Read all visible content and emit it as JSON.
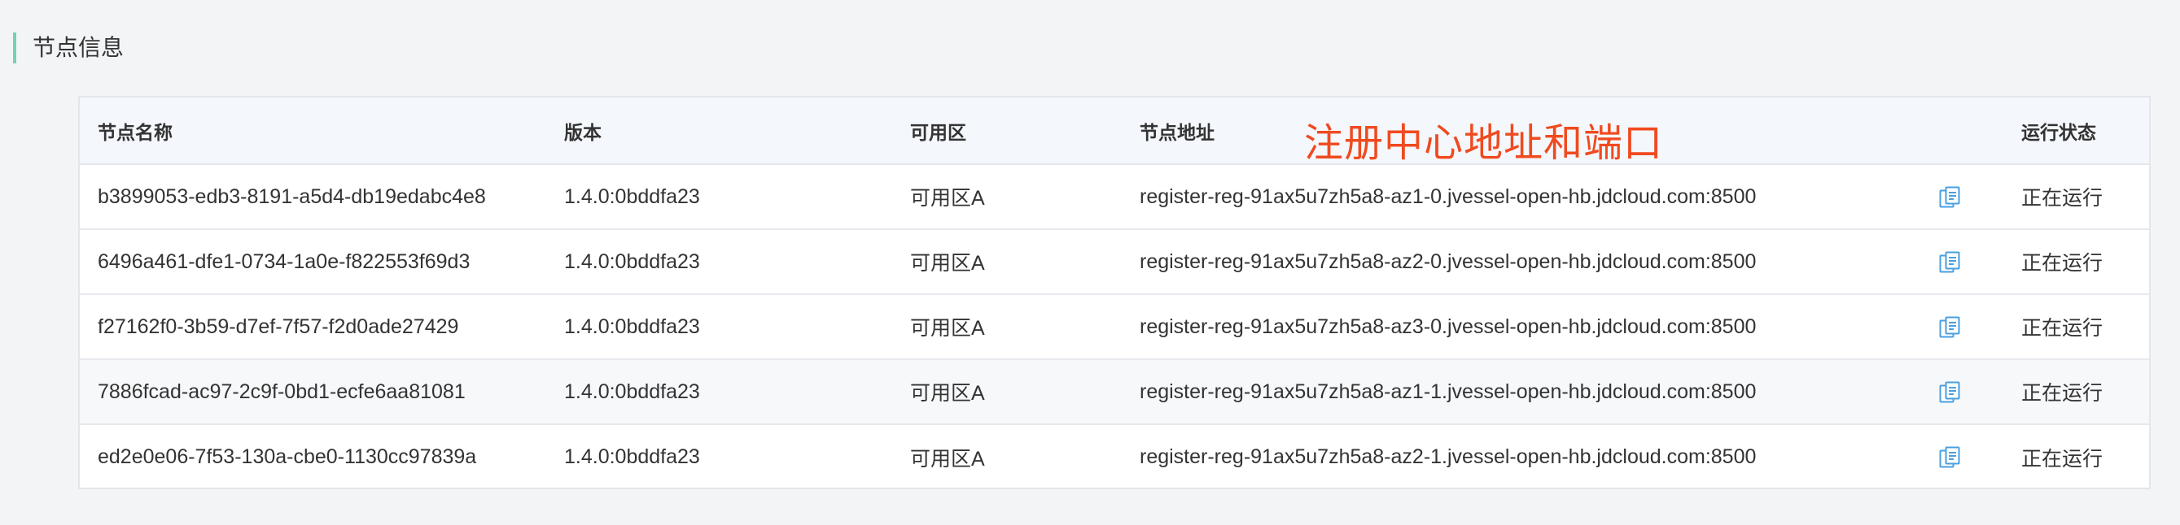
{
  "section": {
    "title": "节点信息"
  },
  "table": {
    "headers": {
      "name": "节点名称",
      "version": "版本",
      "zone": "可用区",
      "address": "节点地址",
      "status": "运行状态"
    },
    "rows": [
      {
        "name": "b3899053-edb3-8191-a5d4-db19edabc4e8",
        "version": "1.4.0:0bddfa23",
        "zone": "可用区A",
        "address": "register-reg-91ax5u7zh5a8-az1-0.jvessel-open-hb.jdcloud.com:8500",
        "status": "正在运行"
      },
      {
        "name": "6496a461-dfe1-0734-1a0e-f822553f69d3",
        "version": "1.4.0:0bddfa23",
        "zone": "可用区A",
        "address": "register-reg-91ax5u7zh5a8-az2-0.jvessel-open-hb.jdcloud.com:8500",
        "status": "正在运行"
      },
      {
        "name": "f27162f0-3b59-d7ef-7f57-f2d0ade27429",
        "version": "1.4.0:0bddfa23",
        "zone": "可用区A",
        "address": "register-reg-91ax5u7zh5a8-az3-0.jvessel-open-hb.jdcloud.com:8500",
        "status": "正在运行"
      },
      {
        "name": "7886fcad-ac97-2c9f-0bd1-ecfe6aa81081",
        "version": "1.4.0:0bddfa23",
        "zone": "可用区A",
        "address": "register-reg-91ax5u7zh5a8-az1-1.jvessel-open-hb.jdcloud.com:8500",
        "status": "正在运行"
      },
      {
        "name": "ed2e0e06-7f53-130a-cbe0-1130cc97839a",
        "version": "1.4.0:0bddfa23",
        "zone": "可用区A",
        "address": "register-reg-91ax5u7zh5a8-az2-1.jvessel-open-hb.jdcloud.com:8500",
        "status": "正在运行"
      }
    ]
  },
  "annotation": {
    "text": "注册中心地址和端口"
  },
  "icons": {
    "copy": "copy-icon"
  },
  "colors": {
    "accent_bar": "#6fd2b4",
    "annotation": "#f04a1f",
    "copy_icon": "#4a9fe0"
  }
}
